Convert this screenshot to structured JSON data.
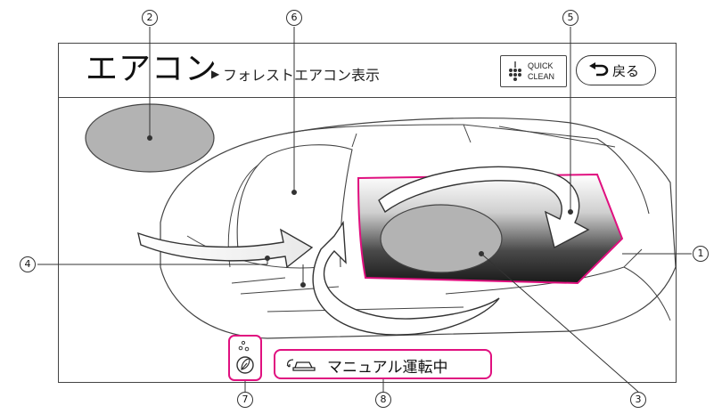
{
  "header": {
    "title": "エアコン",
    "arrow": "▶",
    "subtitle": "フォレストエアコン表示"
  },
  "quick_clean": {
    "line1": "QUICK",
    "line2": "CLEAN",
    "icon": "quick-clean-dots-icon"
  },
  "back_button": {
    "label": "戻る",
    "icon": "return-arrow-icon"
  },
  "status": {
    "icon": "car-recirculation-icon",
    "text": "マニュアル運転中"
  },
  "eco": {
    "icon": "leaf-bubbles-icon"
  },
  "callouts": {
    "c1": "1",
    "c2": "2",
    "c3": "3",
    "c4": "4",
    "c5": "5",
    "c6": "6",
    "c7": "7",
    "c8": "8"
  },
  "colors": {
    "highlight": "#e0107f",
    "line": "#333333",
    "placeholder": "#b3b3b3"
  }
}
